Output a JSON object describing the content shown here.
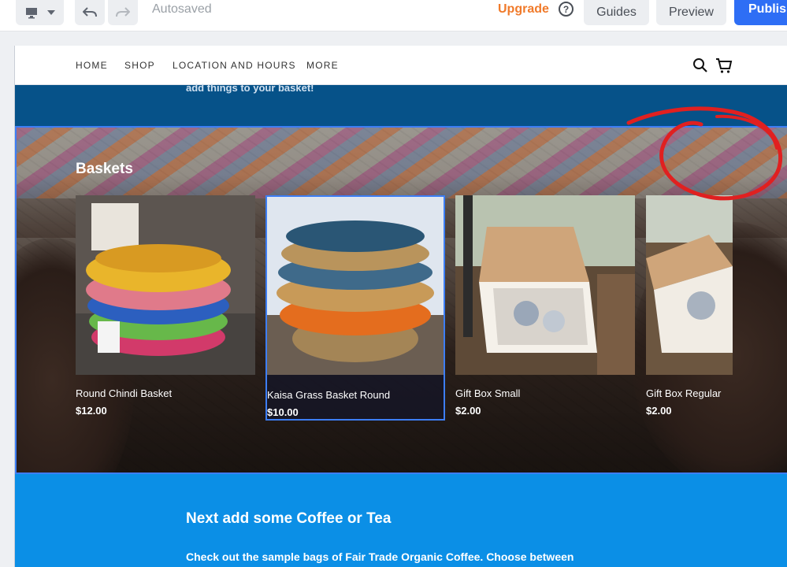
{
  "toolbar": {
    "autosaved": "Autosaved",
    "upgrade": "Upgrade",
    "help": "?",
    "guides": "Guides",
    "preview": "Preview",
    "publish": "Publish"
  },
  "site": {
    "nav": [
      "HOME",
      "SHOP",
      "LOCATION AND HOURS",
      "MORE"
    ],
    "intro_text": "add things to your basket!",
    "section_title": "Baskets",
    "products": [
      {
        "name": "Round Chindi Basket",
        "price": "$12.00"
      },
      {
        "name": "Kaisa Grass Basket Round",
        "price": "$10.00"
      },
      {
        "name": "Gift Box Small",
        "price": "$2.00"
      },
      {
        "name": "Gift Box Regular",
        "price": "$2.00"
      }
    ],
    "next_title": "Next add some Coffee or Tea",
    "next_desc": "Check out the sample bags of Fair Trade Organic Coffee. Choose between"
  },
  "colors": {
    "accent": "#2e6ef5",
    "upgrade": "#f07a2a",
    "intro_band": "#065289",
    "next_band": "#0b8fe6",
    "annotation": "#e02020"
  },
  "icons": [
    "desktop-icon",
    "caret-down-icon",
    "undo-icon",
    "redo-icon",
    "help-icon",
    "search-icon",
    "cart-icon"
  ]
}
